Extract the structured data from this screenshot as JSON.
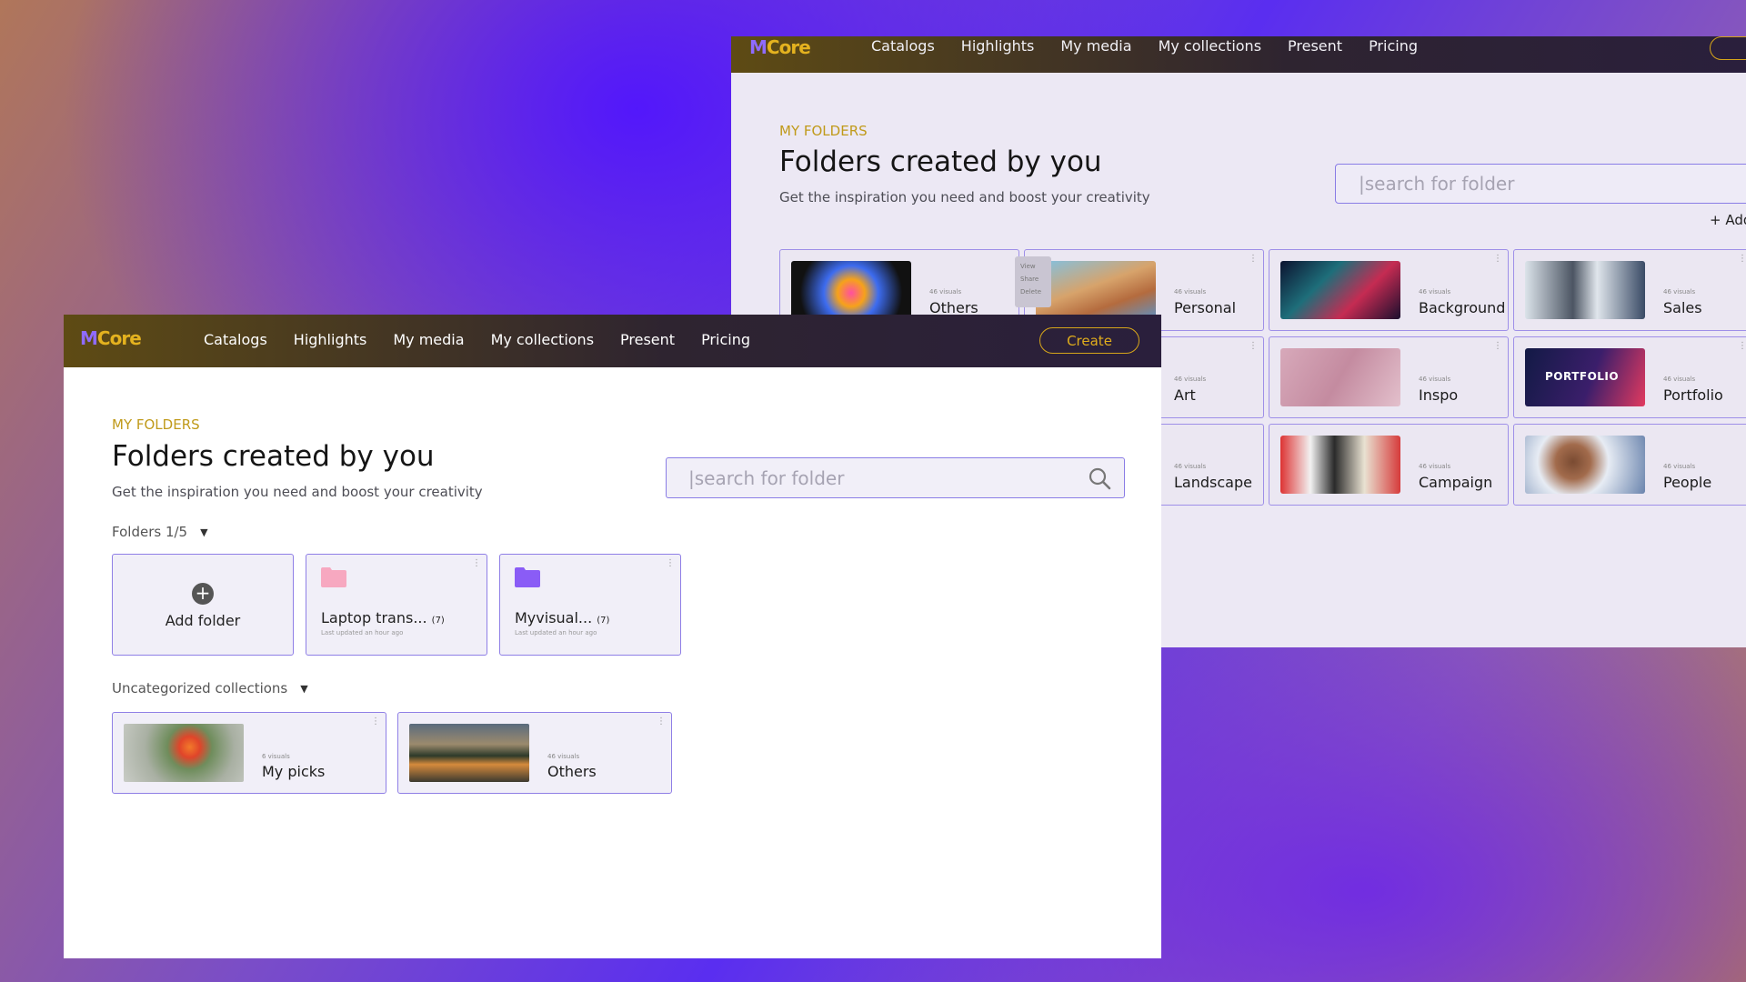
{
  "back_window": {
    "logo": {
      "m": "M",
      "rest": "Core"
    },
    "nav": [
      "Catalogs",
      "Highlights",
      "My media",
      "My collections",
      "Present",
      "Pricing"
    ],
    "create_label": "C",
    "eyebrow": "MY FOLDERS",
    "title": "Folders created by you",
    "subtitle": "Get the inspiration you need and boost your creativity",
    "search_placeholder": "|search for folder",
    "add_label": "+ Add",
    "context_menu": [
      "View",
      "Share",
      "Delete"
    ],
    "collections": [
      {
        "name": "Others",
        "visuals": "46 visuals",
        "thumb": "colorful-smoke"
      },
      {
        "name": "Personal",
        "visuals": "46 visuals",
        "thumb": "family-selfie"
      },
      {
        "name": "Background",
        "visuals": "46 visuals",
        "thumb": "abstract-waves"
      },
      {
        "name": "Sales",
        "visuals": "46 visuals",
        "thumb": "office-team"
      },
      {
        "name": "Art",
        "visuals": "46 visuals",
        "thumb": ""
      },
      {
        "name": "Inspo",
        "visuals": "46 visuals",
        "thumb": "pink-fabric"
      },
      {
        "name": "Portfolio",
        "visuals": "46 visuals",
        "thumb": "portfolio-banner",
        "thumb_text": "PORTFOLIO"
      },
      {
        "name": "Landscape",
        "visuals": "46 visuals",
        "thumb": ""
      },
      {
        "name": "Campaign",
        "visuals": "46 visuals",
        "thumb": "fashion-campaign"
      },
      {
        "name": "People",
        "visuals": "46 visuals",
        "thumb": "smiling-woman"
      }
    ]
  },
  "front_window": {
    "logo": {
      "m": "M",
      "rest": "Core"
    },
    "nav": [
      "Catalogs",
      "Highlights",
      "My media",
      "My collections",
      "Present",
      "Pricing"
    ],
    "create_label": "Create",
    "eyebrow": "MY FOLDERS",
    "title": "Folders created by you",
    "subtitle": "Get the inspiration you need and boost your creativity",
    "search_placeholder": "|search for folder",
    "folders_label": "Folders 1/5",
    "add_folder_label": "Add folder",
    "folders": [
      {
        "name": "Laptop trans...",
        "count": "(7)",
        "updated": "Last updated an hour ago",
        "color": "#f7a8c0"
      },
      {
        "name": "Myvisual...",
        "count": "(7)",
        "updated": "Last updated an hour ago",
        "color": "#8a5cf6"
      }
    ],
    "uncategorized_label": "Uncategorized collections",
    "collections": [
      {
        "name": "My picks",
        "visuals": "6 visuals",
        "thumb": "tulip"
      },
      {
        "name": "Others",
        "visuals": "46 visuals",
        "thumb": "lake-sunset"
      }
    ]
  }
}
